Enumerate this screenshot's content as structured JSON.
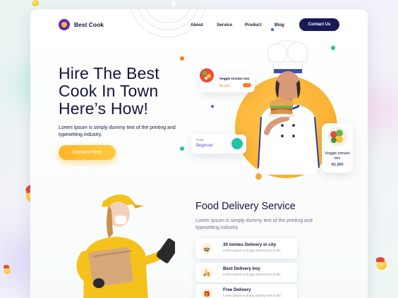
{
  "nav": {
    "brand": "Best Cook",
    "links": [
      "About",
      "Service",
      "Product",
      "Blog"
    ],
    "cta": "Contact Us"
  },
  "hero": {
    "title_line1": "Hire The Best",
    "title_line2": "Cook In Town",
    "title_line3": "Here’s How!",
    "subtitle": "Lorem Ipsum is simply dummy text of the printing and typesetting industry.",
    "cta": "Contact Here"
  },
  "floating": {
    "dish_card": {
      "name": "Veggie tomato mix",
      "price": "₦1,800"
    },
    "cook_card": {
      "label": "Cook",
      "level": "Beginner"
    },
    "veg_card": {
      "name": "Veggie tomato mix",
      "price": "N1,900"
    }
  },
  "delivery": {
    "title": "Food Delivery Service",
    "subtitle": "Lorem Ipsum is simply dummy text of the printing and typesetting industry.",
    "features": [
      {
        "title": "30 mintes Delivery in city",
        "desc": "Lorem Ipsum is simply dummy text of the"
      },
      {
        "title": "Best Delivery boy",
        "desc": "Lorem Ipsum is simply dummy text of the"
      },
      {
        "title": "Free Delivery",
        "desc": "Lorem Ipsum is simply dummy text of the"
      }
    ]
  },
  "colors": {
    "navy": "#171a55",
    "accent": "#ffb52a",
    "purple": "#5b2bb5",
    "teal": "#1fc5a0",
    "orange": "#f57c2a"
  },
  "icons": [
    "logo-icon",
    "sandwich-icon",
    "chef-avatar-icon",
    "salad-icon",
    "clock-icon",
    "delivery-boy-icon",
    "gift-icon",
    "emoji-chef-icon"
  ]
}
